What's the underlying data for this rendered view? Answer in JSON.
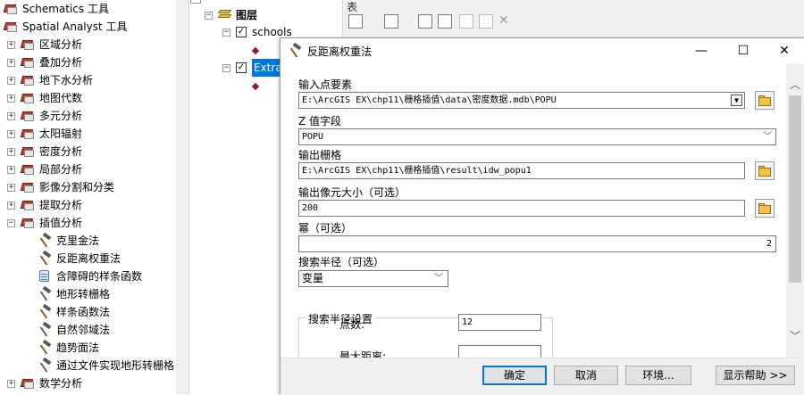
{
  "toolbox": {
    "items": [
      {
        "label": "Schematics 工具",
        "kind": "toolbox",
        "expander": ""
      },
      {
        "label": "Spatial Analyst 工具",
        "kind": "toolbox",
        "expander": ""
      },
      {
        "label": "区域分析",
        "kind": "toolset",
        "expander": "+"
      },
      {
        "label": "叠加分析",
        "kind": "toolset",
        "expander": "+"
      },
      {
        "label": "地下水分析",
        "kind": "toolset",
        "expander": "+"
      },
      {
        "label": "地图代数",
        "kind": "toolset",
        "expander": "+"
      },
      {
        "label": "多元分析",
        "kind": "toolset",
        "expander": "+"
      },
      {
        "label": "太阳辐射",
        "kind": "toolset",
        "expander": "+"
      },
      {
        "label": "密度分析",
        "kind": "toolset",
        "expander": "+"
      },
      {
        "label": "局部分析",
        "kind": "toolset",
        "expander": "+"
      },
      {
        "label": "影像分割和分类",
        "kind": "toolset",
        "expander": "+"
      },
      {
        "label": "提取分析",
        "kind": "toolset",
        "expander": "+"
      },
      {
        "label": "插值分析",
        "kind": "toolset",
        "expander": "−"
      },
      {
        "label": "克里金法",
        "kind": "tool",
        "expander": ""
      },
      {
        "label": "反距离权重法",
        "kind": "tool",
        "expander": ""
      },
      {
        "label": "含障碍的样条函数",
        "kind": "script",
        "expander": ""
      },
      {
        "label": "地形转栅格",
        "kind": "tool",
        "expander": ""
      },
      {
        "label": "样条函数法",
        "kind": "tool",
        "expander": ""
      },
      {
        "label": "自然邻域法",
        "kind": "tool",
        "expander": ""
      },
      {
        "label": "趋势面法",
        "kind": "tool",
        "expander": ""
      },
      {
        "label": "通过文件实现地形转栅格",
        "kind": "tool",
        "expander": ""
      },
      {
        "label": "数学分析",
        "kind": "toolset",
        "expander": "+"
      }
    ]
  },
  "toc": {
    "root": "图层",
    "layers": [
      {
        "label": "schools",
        "checked": true
      },
      {
        "label": "Extra",
        "checked": true
      }
    ]
  },
  "table_window": {
    "title": "表"
  },
  "dialog": {
    "title": "反距离权重法",
    "controls": {
      "minimize": "—",
      "maximize": "☐",
      "close": "✕"
    },
    "input_points_label": "输入点要素",
    "input_points_value": "E:\\ArcGIS EX\\chp11\\栅格插值\\data\\密度数据.mdb\\POPU",
    "z_field_label": "Z 值字段",
    "z_field_value": "POPU",
    "output_raster_label": "输出栅格",
    "output_raster_value": "E:\\ArcGIS EX\\chp11\\栅格插值\\result\\idw_popu1",
    "cell_size_label": "输出像元大小（可选）",
    "cell_size_value": "200",
    "power_label": "幂（可选）",
    "power_value": "2",
    "search_radius_label": "搜索半径（可选）",
    "search_radius_value": "变量",
    "search_settings_label": "搜索半径设置",
    "points_label": "点数:",
    "points_value": "12",
    "max_distance_label": "最大距离:",
    "buttons": {
      "ok": "确定",
      "cancel": "取消",
      "environments": "环境...",
      "show_help": "显示帮助 >>"
    }
  }
}
